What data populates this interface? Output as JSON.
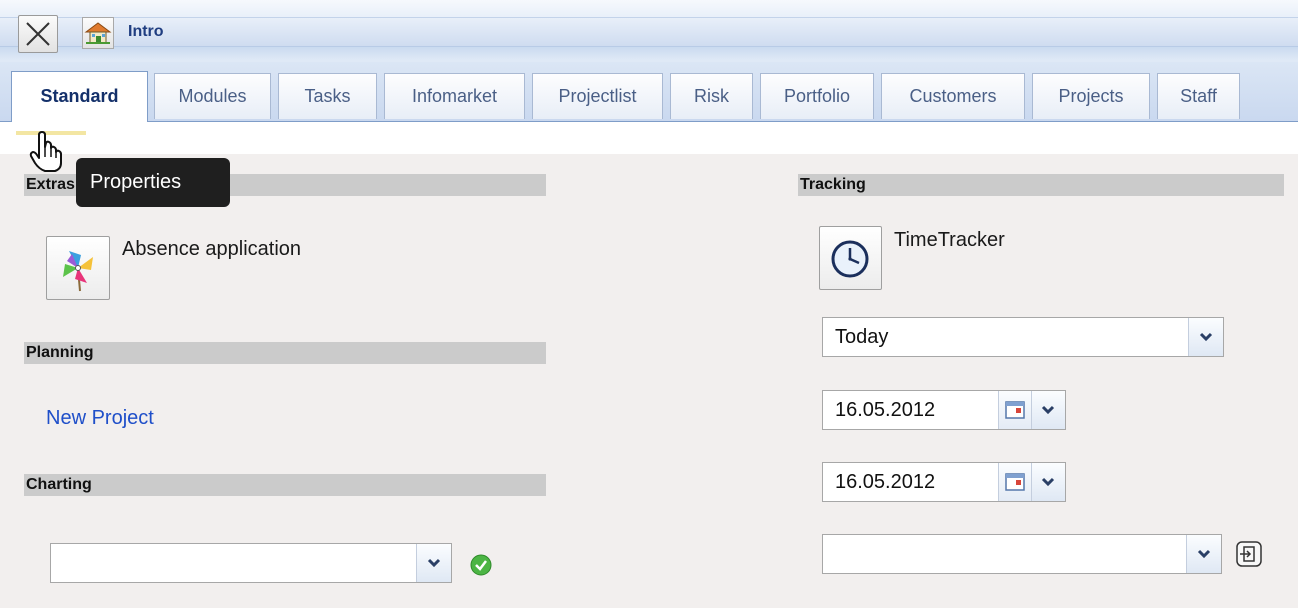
{
  "window": {
    "title": "Intro",
    "close_icon": "close-x-icon",
    "home_icon": "home-icon"
  },
  "tabs": [
    {
      "label": "Standard",
      "active": true
    },
    {
      "label": "Modules"
    },
    {
      "label": "Tasks"
    },
    {
      "label": "Infomarket"
    },
    {
      "label": "Projectlist"
    },
    {
      "label": "Risk"
    },
    {
      "label": "Portfolio"
    },
    {
      "label": "Customers"
    },
    {
      "label": "Projects"
    },
    {
      "label": "Staff"
    }
  ],
  "tooltip": {
    "text": "Properties"
  },
  "sections": {
    "extras": {
      "title": "Extras",
      "items": [
        {
          "label": "Absence application",
          "icon": "pinwheel-icon"
        }
      ]
    },
    "planning": {
      "title": "Planning",
      "link": "New Project"
    },
    "charting": {
      "title": "Charting",
      "select_value": "",
      "confirm_icon": "green-check-icon"
    },
    "tracking": {
      "title": "Tracking",
      "app_label": "TimeTracker",
      "app_icon": "clock-icon",
      "period_value": "Today",
      "date_from": "16.05.2012",
      "date_to": "16.05.2012",
      "project_select_value": "",
      "export_icon": "export-icon"
    }
  },
  "colors": {
    "accent_blue": "#1f4fc9",
    "section_bar": "#cbcbcb",
    "content_bg": "#f2efee"
  }
}
